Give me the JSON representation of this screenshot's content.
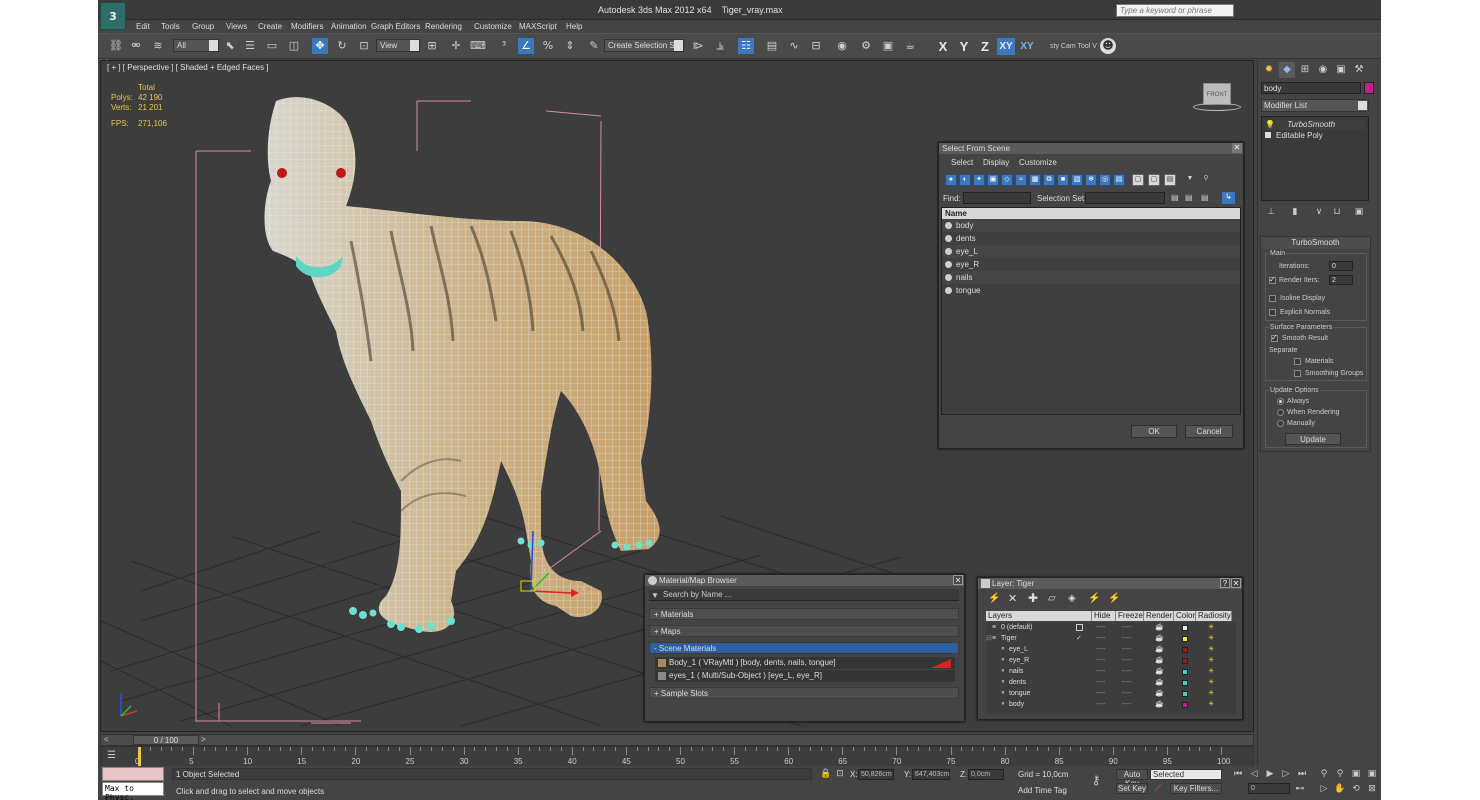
{
  "title": {
    "app": "Autodesk 3ds Max  2012 x64",
    "file": "Tiger_vray.max",
    "search_placeholder": "Type a keyword or phrase"
  },
  "menu": [
    "Edit",
    "Tools",
    "Group",
    "Views",
    "Create",
    "Modifiers",
    "Animation",
    "Graph Editors",
    "Rendering",
    "Customize",
    "MAXScript",
    "Help"
  ],
  "toolbar": {
    "filter_value": "All",
    "ref_coord_value": "View",
    "named_set_value": "Create Selection Se",
    "axes": [
      "X",
      "Y",
      "Z",
      "XY",
      "XY"
    ],
    "cam_tool": "sty Cam Tool V"
  },
  "viewport": {
    "label": "[ + ] [ Perspective ] [ Shaded + Edged Faces ]",
    "stats": {
      "total_label": "Total",
      "polys_label": "Polys:",
      "polys": "42 190",
      "verts_label": "Verts:",
      "verts": "21 201",
      "fps_label": "FPS:",
      "fps": "271,106"
    },
    "viewcube_label": "FRONT"
  },
  "command_panel": {
    "object_name": "body",
    "object_color": "#c3208f",
    "modifier_list": "Modifier List",
    "stack": [
      "TurboSmooth",
      "Editable Poly"
    ],
    "turbosmooth": {
      "title": "TurboSmooth",
      "main_label": "Main",
      "iterations_label": "Iterations:",
      "iterations": "0",
      "render_iters_label": "Render Iters:",
      "render_iters": "2",
      "isoline": "Isoline Display",
      "explicit": "Explicit Normals",
      "surface_label": "Surface Parameters",
      "smooth_result": "Smooth Result",
      "separate_label": "Separate",
      "materials": "Materials",
      "smoothing_groups": "Smoothing Groups",
      "update_label": "Update Options",
      "always": "Always",
      "when_rendering": "When Rendering",
      "manually": "Manually",
      "update_button": "Update"
    }
  },
  "select_from_scene": {
    "title": "Select From Scene",
    "menu": [
      "Select",
      "Display",
      "Customize"
    ],
    "find_label": "Find:",
    "set_label": "Selection Set:",
    "column": "Name",
    "items": [
      "body",
      "dents",
      "eye_L",
      "eye_R",
      "nails",
      "tongue"
    ],
    "ok": "OK",
    "cancel": "Cancel"
  },
  "material_browser": {
    "title": "Material/Map Browser",
    "search": "Search by Name ...",
    "sections": [
      "+ Materials",
      "+ Maps",
      "- Scene Materials",
      "+ Sample Slots"
    ],
    "items": [
      "Body_1  ( VRayMtl ) [body, dents, nails, tongue]",
      "eyes_1  ( Multi/Sub-Object ) [eye_L, eye_R]"
    ]
  },
  "layer_dialog": {
    "title": "Layer: Tiger",
    "help": "?",
    "columns": [
      "Layers",
      "Hide",
      "Freeze",
      "Render",
      "Color",
      "Radiosity"
    ],
    "rows": [
      {
        "name": "0 (default)",
        "color": "#e8e8e8",
        "indent": 1
      },
      {
        "name": "Tiger",
        "color": "#e8e830",
        "indent": 1
      },
      {
        "name": "eye_L",
        "color": "#a01818",
        "indent": 2
      },
      {
        "name": "eye_R",
        "color": "#a01818",
        "indent": 2
      },
      {
        "name": "nails",
        "color": "#40d0c0",
        "indent": 2
      },
      {
        "name": "dents",
        "color": "#40d0c0",
        "indent": 2
      },
      {
        "name": "tongue",
        "color": "#40d0c0",
        "indent": 2
      },
      {
        "name": "body",
        "color": "#c3208f",
        "indent": 2
      }
    ]
  },
  "timeline": {
    "frame": "0 / 100",
    "ticks": [
      "0",
      "5",
      "10",
      "15",
      "20",
      "25",
      "30",
      "35",
      "40",
      "45",
      "50",
      "55",
      "60",
      "65",
      "70",
      "75",
      "80",
      "85",
      "90",
      "95",
      "100"
    ]
  },
  "status": {
    "maxscript": "Max to Physc.",
    "selected": "1 Object Selected",
    "prompt": "Click and drag to select and move objects",
    "x_label": "X:",
    "x": "50,826cm",
    "y_label": "Y:",
    "y": "647,403cm",
    "z_label": "Z:",
    "z": "0,0cm",
    "grid": "Grid = 10,0cm",
    "add_time_tag": "Add Time Tag",
    "auto_key": "Auto Key",
    "set_key": "Set Key",
    "selected_dd": "Selected",
    "key_filters": "Key Filters...",
    "frame": "0"
  }
}
